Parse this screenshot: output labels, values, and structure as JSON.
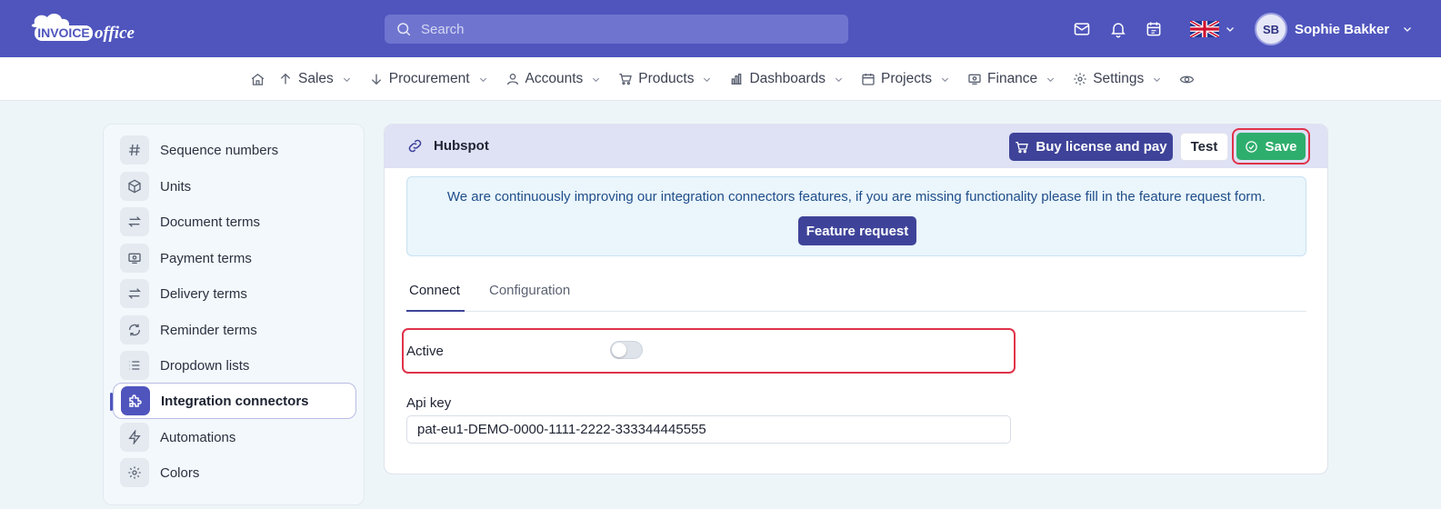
{
  "brand": {
    "logo_text_1": "INVOICE",
    "logo_text_2": "office"
  },
  "search": {
    "placeholder": "Search"
  },
  "user": {
    "initials": "SB",
    "name": "Sophie Bakker"
  },
  "topbar_icons": [
    "mail-icon",
    "bell-icon",
    "calendar-icon",
    "uk-flag-icon"
  ],
  "nav": {
    "items": [
      {
        "label": "Sales",
        "icon": "arrow-up-icon"
      },
      {
        "label": "Procurement",
        "icon": "arrow-down-icon"
      },
      {
        "label": "Accounts",
        "icon": "user-icon"
      },
      {
        "label": "Products",
        "icon": "cart-icon"
      },
      {
        "label": "Dashboards",
        "icon": "bar-chart-icon"
      },
      {
        "label": "Projects",
        "icon": "calendar-icon"
      },
      {
        "label": "Finance",
        "icon": "money-icon"
      },
      {
        "label": "Settings",
        "icon": "gear-icon"
      }
    ]
  },
  "sidebar": {
    "items": [
      {
        "label": "Sequence numbers",
        "icon": "hash-icon"
      },
      {
        "label": "Units",
        "icon": "cube-icon"
      },
      {
        "label": "Document terms",
        "icon": "swap-icon"
      },
      {
        "label": "Payment terms",
        "icon": "cash-icon"
      },
      {
        "label": "Delivery terms",
        "icon": "swap-icon"
      },
      {
        "label": "Reminder terms",
        "icon": "refresh-icon"
      },
      {
        "label": "Dropdown lists",
        "icon": "list-icon"
      },
      {
        "label": "Integration connectors",
        "icon": "puzzle-icon",
        "active": true
      },
      {
        "label": "Automations",
        "icon": "bolt-icon"
      },
      {
        "label": "Colors",
        "icon": "gear-icon"
      }
    ]
  },
  "card": {
    "title": "Hubspot",
    "buy_label": "Buy license and pay",
    "test_label": "Test",
    "save_label": "Save",
    "info_text": "We are continuously improving our integration connectors features, if you are missing functionality please fill in the feature request form.",
    "feature_label": "Feature request",
    "tabs": [
      {
        "label": "Connect",
        "active": true
      },
      {
        "label": "Configuration",
        "active": false
      }
    ],
    "active_label": "Active",
    "active_value": false,
    "api_key_label": "Api key",
    "api_key_value": "pat-eu1-DEMO-0000-1111-2222-333344445555"
  },
  "colors": {
    "brand": "#4f55bd",
    "primary_button": "#3e4399",
    "save_green": "#2eae6d",
    "highlight_red": "#e0334a"
  }
}
